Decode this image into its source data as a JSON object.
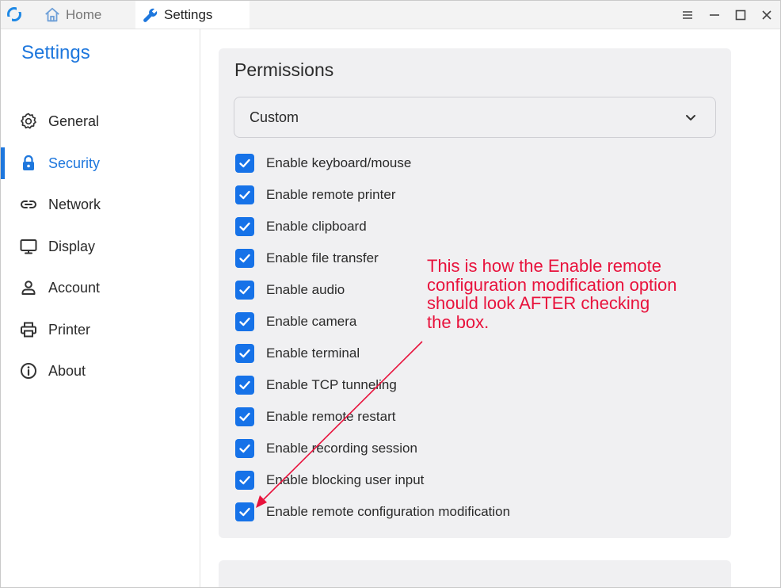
{
  "window": {
    "tabs": [
      {
        "label": "Home",
        "icon": "home-icon"
      },
      {
        "label": "Settings",
        "icon": "wrench-icon"
      }
    ]
  },
  "sidebar": {
    "title": "Settings",
    "items": [
      {
        "label": "General",
        "icon": "gear-icon",
        "active": false
      },
      {
        "label": "Security",
        "icon": "lock-icon",
        "active": true
      },
      {
        "label": "Network",
        "icon": "link-icon",
        "active": false
      },
      {
        "label": "Display",
        "icon": "monitor-icon",
        "active": false
      },
      {
        "label": "Account",
        "icon": "person-icon",
        "active": false
      },
      {
        "label": "Printer",
        "icon": "printer-icon",
        "active": false
      },
      {
        "label": "About",
        "icon": "info-icon",
        "active": false
      }
    ]
  },
  "permissions": {
    "title": "Permissions",
    "mode": "Custom",
    "options": [
      {
        "label": "Enable keyboard/mouse",
        "checked": true
      },
      {
        "label": "Enable remote printer",
        "checked": true
      },
      {
        "label": "Enable clipboard",
        "checked": true
      },
      {
        "label": "Enable file transfer",
        "checked": true
      },
      {
        "label": "Enable audio",
        "checked": true
      },
      {
        "label": "Enable camera",
        "checked": true
      },
      {
        "label": "Enable terminal",
        "checked": true
      },
      {
        "label": "Enable TCP tunneling",
        "checked": true
      },
      {
        "label": "Enable remote restart",
        "checked": true
      },
      {
        "label": "Enable recording session",
        "checked": true
      },
      {
        "label": "Enable blocking user input",
        "checked": true
      },
      {
        "label": "Enable remote configuration modification",
        "checked": true
      }
    ]
  },
  "annotation": {
    "lines": [
      "This is how the Enable remote",
      "configuration modification option",
      "should look AFTER checking",
      "the box."
    ]
  },
  "colors": {
    "accent": "#1e77dd",
    "checkbox": "#1672e8",
    "annotation": "#e8123c",
    "panel": "#f0f0f2"
  }
}
